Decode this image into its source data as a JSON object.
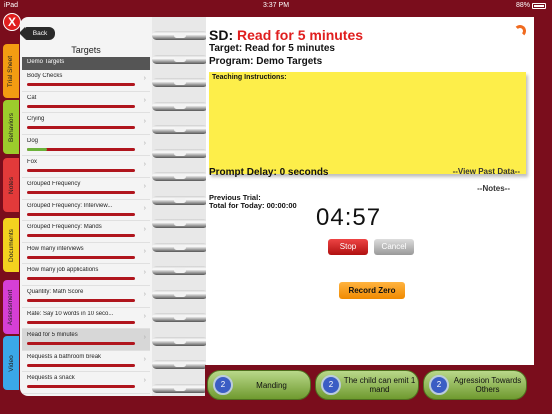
{
  "status": {
    "carrier": "iPad",
    "time": "3:37 PM",
    "battery": "88%"
  },
  "tabs": [
    "Trial Sheet",
    "Behaviors",
    "Notes",
    "Documents",
    "Assessment",
    "Video"
  ],
  "colors": {
    "tabs": [
      "#f39c12",
      "#9ccc2c",
      "#e33a3a",
      "#f4d21f",
      "#d63fd6",
      "#3aa7e8"
    ],
    "frame": "#7a0d1c",
    "accent": "#e01e1e"
  },
  "nav": {
    "close": "X",
    "back": "Back",
    "title": "Targets"
  },
  "targets": [
    {
      "label": "Demo Targets",
      "type": "header"
    },
    {
      "label": "Body Checks"
    },
    {
      "label": "Cat"
    },
    {
      "label": "Crying"
    },
    {
      "label": "Dog",
      "progress": "green"
    },
    {
      "label": "Fox"
    },
    {
      "label": "Grouped Frequency"
    },
    {
      "label": "Grouped Frequency: Interview..."
    },
    {
      "label": "Grouped Frequency: Mands"
    },
    {
      "label": "How many interviews"
    },
    {
      "label": "How many job applications"
    },
    {
      "label": "Quantity: Math Score"
    },
    {
      "label": "Rate: Say 10 words in 10 seco..."
    },
    {
      "label": "Read for 5 minutes",
      "selected": true
    },
    {
      "label": "Requests a bathroom break"
    },
    {
      "label": "Requests a snack"
    }
  ],
  "detail": {
    "sd_prefix": "SD:",
    "sd_value": "Read for 5 minutes",
    "target": "Target: Read for 5 minutes",
    "program": "Program: Demo Targets",
    "teaching_label": "Teaching Instructions:",
    "prompt_delay": "Prompt Delay: 0 seconds",
    "view_past": "--View Past Data--",
    "notes": "--Notes--",
    "previous_trial": "Previous Trial:",
    "total_today": "Total for Today: 00:00:00",
    "timer": "04:57",
    "stop": "Stop",
    "cancel": "Cancel",
    "record_zero": "Record Zero"
  },
  "bottom": [
    {
      "count": "2",
      "label": "Manding"
    },
    {
      "count": "2",
      "label": "The child can emit 1 mand"
    },
    {
      "count": "2",
      "label": "Agression Towards Others"
    }
  ]
}
